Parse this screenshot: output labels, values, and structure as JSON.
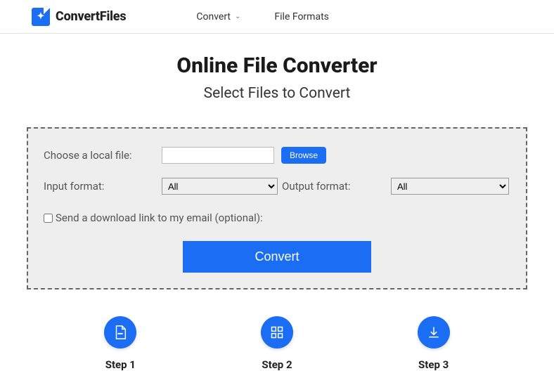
{
  "brand": {
    "name": "ConvertFiles"
  },
  "nav": {
    "convert": "Convert",
    "formats": "File Formats"
  },
  "hero": {
    "title": "Online File Converter",
    "subtitle": "Select Files to Convert"
  },
  "form": {
    "choose_label": "Choose a local file:",
    "file_value": "",
    "browse": "Browse",
    "input_format_label": "Input format:",
    "input_format_value": "All",
    "output_format_label": "Output format:",
    "output_format_value": "All",
    "email_label": "Send a download link to my email (optional):",
    "convert": "Convert"
  },
  "steps": {
    "s1": "Step 1",
    "s2": "Step 2",
    "s3": "Step 3"
  }
}
